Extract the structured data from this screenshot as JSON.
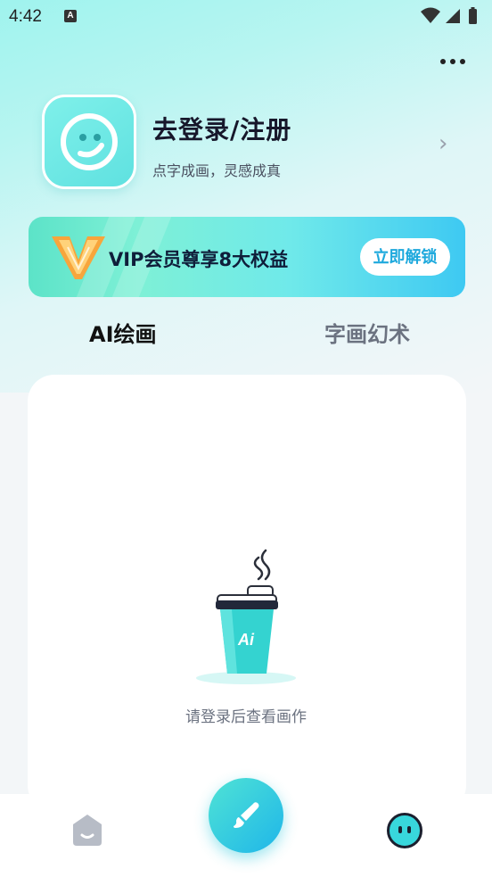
{
  "status_bar": {
    "time": "4:42",
    "notification_badge": "A"
  },
  "header": {
    "more_icon": "more-horizontal-icon"
  },
  "profile": {
    "title": "去登录/注册",
    "subtitle": "点字成画，灵感成真",
    "chevron": "›"
  },
  "vip_banner": {
    "text": "VIP会员尊享8大权益",
    "button_label": "立即解锁"
  },
  "tabs": [
    {
      "label": "AI绘画",
      "active": true
    },
    {
      "label": "字画幻术",
      "active": false
    }
  ],
  "empty_state": {
    "message": "请登录后查看画作",
    "cup_label": "Ai"
  },
  "bottom_nav": {
    "items": [
      {
        "icon": "home-icon"
      },
      {
        "icon": "brush-icon"
      },
      {
        "icon": "profile-face-icon"
      }
    ]
  },
  "colors": {
    "accent": "#4fe3d5",
    "accent_blue": "#1fb6e9",
    "vip_button_text": "#1ea9dd"
  }
}
